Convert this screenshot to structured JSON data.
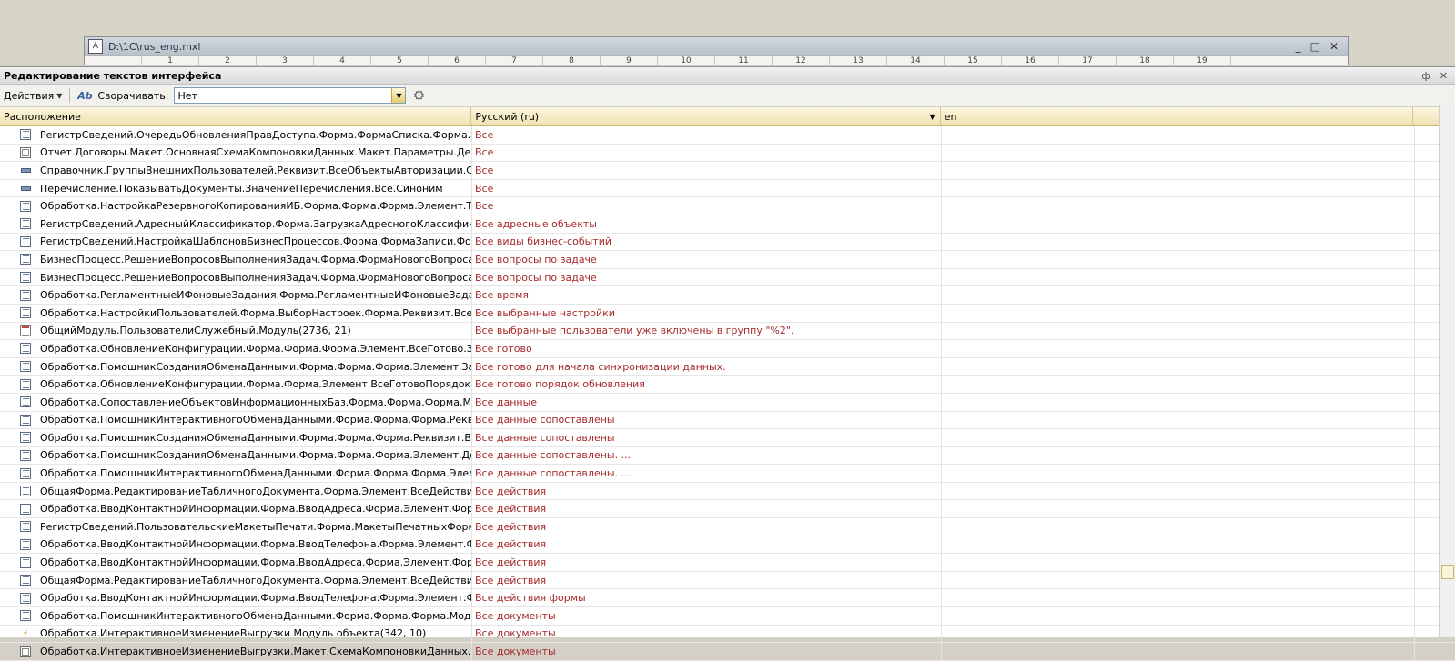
{
  "background_window": {
    "title": "D:\\1C\\rus_eng.mxl",
    "controls": [
      "_",
      "□",
      "✕"
    ],
    "ruler": [
      "",
      "1",
      "2",
      "3",
      "4",
      "5",
      "6",
      "7",
      "8",
      "9",
      "10",
      "11",
      "12",
      "13",
      "14",
      "15",
      "16",
      "17",
      "18",
      "19"
    ]
  },
  "panel": {
    "title": "Редактирование текстов интерфейса",
    "title_controls": [
      "ф",
      "✕"
    ]
  },
  "toolbar": {
    "actions_label": "Действия",
    "collapse_label": "Сворачивать:",
    "collapse_value": "Нет"
  },
  "columns": {
    "location": "Расположение",
    "russian": "Русский (ru)",
    "english": "en"
  },
  "rows": [
    {
      "icon": "form",
      "loc": "РегистрСведений.ОчередьОбновленияПравДоступа.Форма.ФормаСписка.Форма.Элеме...",
      "ru": "Все",
      "en": ""
    },
    {
      "icon": "report",
      "loc": "Отчет.Договоры.Макет.ОсновнаяСхемаКомпоновкиДанных.Макет.Параметры.Действую...",
      "ru": "Все",
      "en": ""
    },
    {
      "icon": "attr",
      "loc": "Справочник.ГруппыВнешнихПользователей.Реквизит.ВсеОбъектыАвторизации.Синоним",
      "ru": "Все",
      "en": ""
    },
    {
      "icon": "attr",
      "loc": "Перечисление.ПоказыватьДокументы.ЗначениеПеречисления.Все.Синоним",
      "ru": "Все",
      "en": ""
    },
    {
      "icon": "form",
      "loc": "Обработка.НастройкаРезервногоКопированияИБ.Форма.Форма.Форма.Элемент.ТипОгр...",
      "ru": "Все",
      "en": ""
    },
    {
      "icon": "form",
      "loc": "РегистрСведений.АдресныйКлассификатор.Форма.ЗагрузкаАдресногоКлассификатора....",
      "ru": "Все адресные объекты",
      "en": ""
    },
    {
      "icon": "form",
      "loc": "РегистрСведений.НастройкаШаблоновБизнесПроцессов.Форма.ФормаЗаписи.Форма.Ре...",
      "ru": "Все виды бизнес-событий",
      "en": ""
    },
    {
      "icon": "form",
      "loc": "БизнесПроцесс.РешениеВопросовВыполненияЗадач.Форма.ФормаНовогоВопроса.Форм...",
      "ru": "Все вопросы по задаче",
      "en": ""
    },
    {
      "icon": "form",
      "loc": "БизнесПроцесс.РешениеВопросовВыполненияЗадач.Форма.ФормаНовогоВопроса.Форм...",
      "ru": "Все вопросы по задаче",
      "en": ""
    },
    {
      "icon": "form",
      "loc": "Обработка.РегламентныеИФоновыеЗадания.Форма.РегламентныеИФоновыеЗадания.Ф...",
      "ru": "Все время",
      "en": ""
    },
    {
      "icon": "form",
      "loc": "Обработка.НастройкиПользователей.Форма.ВыборНастроек.Форма.Реквизит.ВсеВыбра...",
      "ru": "Все выбранные настройки",
      "en": ""
    },
    {
      "icon": "module",
      "loc": "ОбщийМодуль.ПользователиСлужебный.Модуль(2736, 21)",
      "ru": "Все выбранные пользователи уже включены в группу \"%2\".",
      "en": ""
    },
    {
      "icon": "form",
      "loc": "Обработка.ОбновлениеКонфигурации.Форма.Форма.Форма.Элемент.ВсеГотово.Заголовок",
      "ru": "Все готово",
      "en": ""
    },
    {
      "icon": "form",
      "loc": "Обработка.ПомощникСозданияОбменаДанными.Форма.Форма.Форма.Элемент.Заголов...",
      "ru": "Все готово для начала синхронизации данных.",
      "en": ""
    },
    {
      "icon": "form",
      "loc": "Обработка.ОбновлениеКонфигурации.Форма.Форма.Элемент.ВсеГотовоПорядок...",
      "ru": "Все готово порядок обновления",
      "en": ""
    },
    {
      "icon": "form",
      "loc": "Обработка.СопоставлениеОбъектовИнформационныхБаз.Форма.Форма.Форма.Модуль(...",
      "ru": "Все данные",
      "en": ""
    },
    {
      "icon": "form",
      "loc": "Обработка.ПомощникИнтерактивногоОбменаДанными.Форма.Форма.Форма.Реквизит....",
      "ru": "Все данные сопоставлены",
      "en": ""
    },
    {
      "icon": "form",
      "loc": "Обработка.ПомощникСозданияОбменаДанными.Форма.Форма.Форма.Реквизит.ВсеДан...",
      "ru": "Все данные сопоставлены",
      "en": ""
    },
    {
      "icon": "form",
      "loc": "Обработка.ПомощникСозданияОбменаДанными.Форма.Форма.Форма.Элемент.Декора...",
      "ru": "Все данные сопоставлены. ...",
      "en": ""
    },
    {
      "icon": "form",
      "loc": "Обработка.ПомощникИнтерактивногоОбменаДанными.Форма.Форма.Форма.Элемент.П...",
      "ru": "Все данные сопоставлены. ...",
      "en": ""
    },
    {
      "icon": "form",
      "loc": "ОбщаяФорма.РедактированиеТабличногоДокумента.Форма.Элемент.ВсеДействия.Подс...",
      "ru": "Все действия",
      "en": ""
    },
    {
      "icon": "form",
      "loc": "Обработка.ВводКонтактнойИнформации.Форма.ВводАдреса.Форма.Элемент.ФормаВсе...",
      "ru": "Все действия",
      "en": ""
    },
    {
      "icon": "form",
      "loc": "РегистрСведений.ПользовательскиеМакетыПечати.Форма.МакетыПечатныхФорм.Форм...",
      "ru": "Все действия",
      "en": ""
    },
    {
      "icon": "form",
      "loc": "Обработка.ВводКонтактнойИнформации.Форма.ВводТелефона.Форма.Элемент.ФормаВ...",
      "ru": "Все действия",
      "en": ""
    },
    {
      "icon": "form",
      "loc": "Обработка.ВводКонтактнойИнформации.Форма.ВводАдреса.Форма.Элемент.ФормаВсе...",
      "ru": "Все действия",
      "en": ""
    },
    {
      "icon": "form",
      "loc": "ОбщаяФорма.РедактированиеТабличногоДокумента.Форма.Элемент.ВсеДействия.Заго...",
      "ru": "Все действия",
      "en": ""
    },
    {
      "icon": "form",
      "loc": "Обработка.ВводКонтактнойИнформации.Форма.ВводТелефона.Форма.Элемент.ФормаВ...",
      "ru": "Все действия формы",
      "en": ""
    },
    {
      "icon": "form",
      "loc": "Обработка.ПомощникИнтерактивногоОбменаДанными.Форма.Форма.Форма.Модуль(22...",
      "ru": "Все документы",
      "en": ""
    },
    {
      "icon": "objmod",
      "loc": "Обработка.ИнтерактивноеИзменениеВыгрузки.Модуль объекта(342, 10)",
      "ru": "Все документы",
      "en": ""
    },
    {
      "icon": "report",
      "loc": "Обработка.ИнтерактивноеИзменениеВыгрузки.Макет.СхемаКомпоновкиДанных.Макет.Н...",
      "ru": "Все документы",
      "en": ""
    }
  ]
}
